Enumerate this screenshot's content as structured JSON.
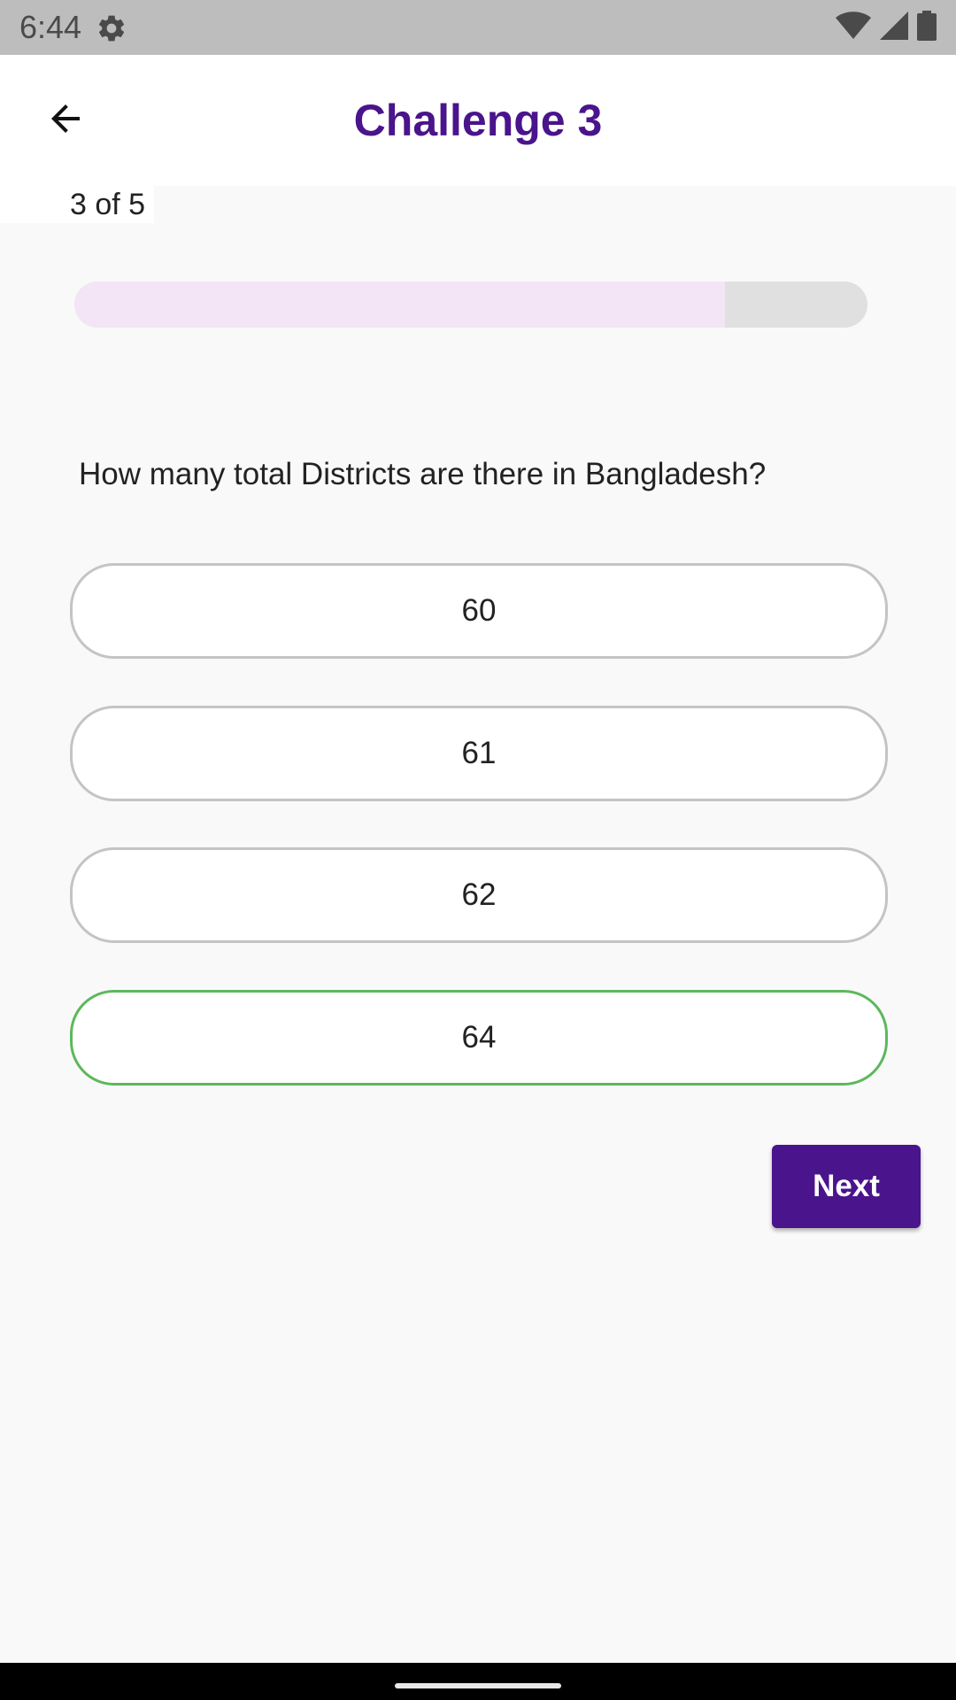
{
  "status_bar": {
    "time": "6:44",
    "icons": [
      "gear-icon",
      "wifi-icon",
      "signal-icon",
      "battery-icon"
    ]
  },
  "app_bar": {
    "title": "Challenge 3",
    "back_icon": "arrow-left-icon"
  },
  "progress": {
    "label": "3 of 5",
    "current": 3,
    "total": 5,
    "fraction": 0.82
  },
  "question": {
    "text": "How many total Districts are there in Bangladesh?"
  },
  "options": [
    {
      "label": "60",
      "state": "default"
    },
    {
      "label": "61",
      "state": "default"
    },
    {
      "label": "62",
      "state": "default"
    },
    {
      "label": "64",
      "state": "correct"
    }
  ],
  "next_button": {
    "label": "Next"
  },
  "colors": {
    "accent": "#4a148c",
    "progress_fill": "#f3e5f5",
    "progress_track": "#e0e0e0",
    "correct_border": "#5cb85c",
    "default_border": "#c4c4c4"
  }
}
